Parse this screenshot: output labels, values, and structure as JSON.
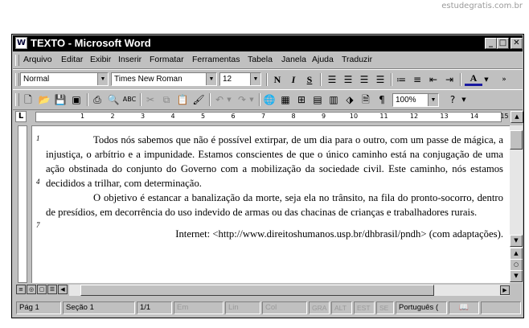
{
  "watermark": "estudegratis.com.br",
  "window": {
    "title": "TEXTO - Microsoft Word",
    "app_icon": "W",
    "minimize": "_",
    "maximize": "□",
    "close": "✕"
  },
  "menu": [
    "Arquivo",
    "Editar",
    "Exibir",
    "Inserir",
    "Formatar",
    "Ferramentas",
    "Tabela",
    "Janela",
    "Ajuda",
    "Traduzir"
  ],
  "formatting": {
    "style": "Normal",
    "font": "Times New Roman",
    "size": "12",
    "bold": "N",
    "italic": "I",
    "underline": "S",
    "font_color": "A"
  },
  "standard": {
    "zoom": "100%"
  },
  "ruler": {
    "corner": "L",
    "ticks": [
      "1",
      "2",
      "3",
      "4",
      "5",
      "6",
      "7",
      "8",
      "9",
      "10",
      "11",
      "12",
      "13",
      "14",
      "15"
    ]
  },
  "document": {
    "line_numbers": [
      "1",
      "4",
      "7"
    ],
    "paragraph1": "Todos nós sabemos que não é possível extirpar, de um dia para o outro, com um passe de mágica, a injustiça, o arbítrio e a impunidade. Estamos conscientes de que o único caminho está na conjugação de uma ação obstinada do conjunto do Governo com a mobilização da sociedade civil. Este caminho, nós estamos decididos a trilhar, com determinação.",
    "paragraph2": "O objetivo é estancar a banalização da morte, seja ela no trânsito, na fila do pronto-socorro, dentro de presídios, em decorrência do uso indevido de armas ou das chacinas de crianças e trabalhadores rurais.",
    "source": "Internet: <http://www.direitoshumanos.usp.br/dhbrasil/pndh> (com adaptações)."
  },
  "status": {
    "page": "Pág 1",
    "section": "Seção 1",
    "pages": "1/1",
    "at": "Em",
    "line": "Lin",
    "col": "Col",
    "rec": "GRA",
    "trk": "ALT",
    "ext": "EST",
    "ovr": "SE",
    "language": "Português (",
    "book": "📖"
  }
}
